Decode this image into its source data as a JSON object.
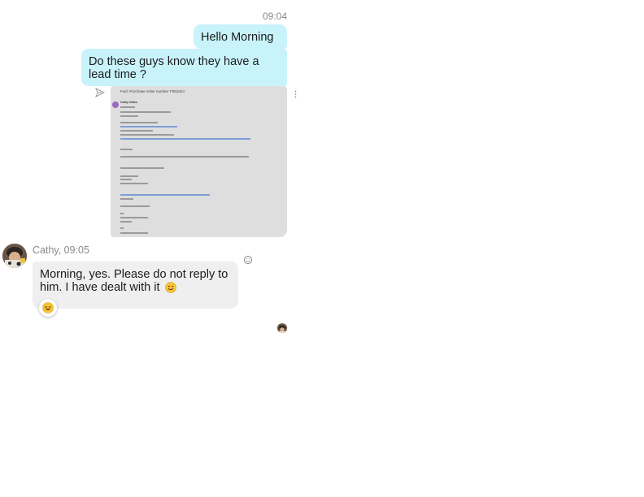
{
  "chat": {
    "timestamp": "09:04",
    "outgoing": [
      {
        "text": "Hello Morning"
      },
      {
        "text": "Do these guys know they have a lead time ?"
      }
    ],
    "attachment": {
      "subject": "Fwd: Purchase order number F051824",
      "sender": "Cathy Gates"
    },
    "incoming": {
      "sender": "Cathy",
      "time": "09:05",
      "sender_line": "Cathy, 09:05",
      "text": "Morning, yes. Please do not reply to him. I have dealt with it"
    },
    "reaction": {
      "emoji": "laughing-emoji"
    },
    "icons": {
      "send": "send-icon",
      "more": "more-options-icon",
      "react": "add-reaction-icon",
      "smile": "smile-emoji-icon",
      "read_receipt": "read-receipt-avatar"
    },
    "colors": {
      "outgoing_bubble": "#c9f3fb",
      "incoming_bubble": "#efefef",
      "timestamp": "#8a8a8a"
    }
  }
}
